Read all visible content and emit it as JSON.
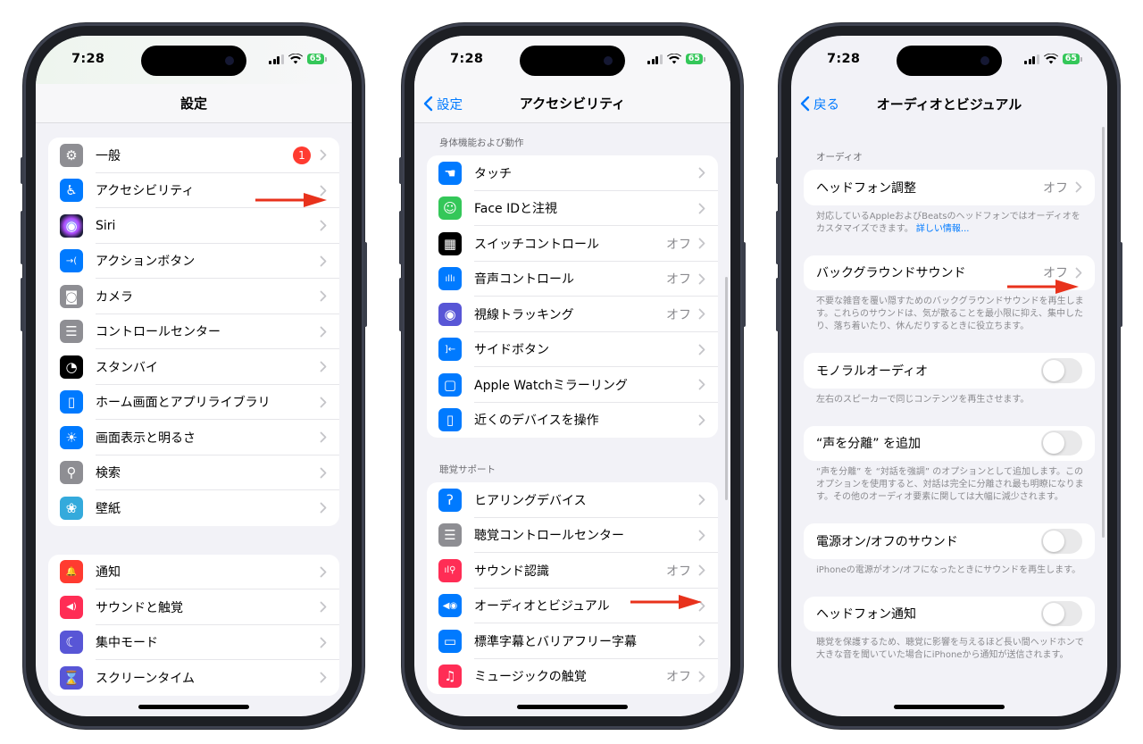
{
  "status_bar": {
    "time": "7:28",
    "battery": "65"
  },
  "phone1": {
    "title": "設定",
    "groups": [
      [
        {
          "label": "一般",
          "icon": "gear-icon",
          "color": "#8e8e93",
          "badge": "1"
        },
        {
          "label": "アクセシビリティ",
          "icon": "accessibility-icon",
          "color": "#007aff",
          "highlighted": true
        },
        {
          "label": "Siri",
          "icon": "siri-icon",
          "color": "#2d2d55"
        },
        {
          "label": "アクションボタン",
          "icon": "action-button-icon",
          "color": "#007aff"
        },
        {
          "label": "カメラ",
          "icon": "camera-icon",
          "color": "#8e8e93"
        },
        {
          "label": "コントロールセンター",
          "icon": "control-center-icon",
          "color": "#8e8e93"
        },
        {
          "label": "スタンバイ",
          "icon": "standby-icon",
          "color": "#000000"
        },
        {
          "label": "ホーム画面とアプリライブラリ",
          "icon": "home-screen-icon",
          "color": "#007aff"
        },
        {
          "label": "画面表示と明るさ",
          "icon": "brightness-icon",
          "color": "#007aff"
        },
        {
          "label": "検索",
          "icon": "search-icon",
          "color": "#8e8e93"
        },
        {
          "label": "壁紙",
          "icon": "wallpaper-icon",
          "color": "#34aadc"
        }
      ],
      [
        {
          "label": "通知",
          "icon": "notification-icon",
          "color": "#ff3b30"
        },
        {
          "label": "サウンドと触覚",
          "icon": "sound-icon",
          "color": "#ff2d55"
        },
        {
          "label": "集中モード",
          "icon": "focus-moon-icon",
          "color": "#5856d6"
        },
        {
          "label": "スクリーンタイム",
          "icon": "hourglass-icon",
          "color": "#5856d6"
        }
      ]
    ]
  },
  "phone2": {
    "back": "設定",
    "title": "アクセシビリティ",
    "sections": [
      {
        "header": "身体機能および動作",
        "items": [
          {
            "label": "タッチ",
            "icon": "touch-hand-icon",
            "color": "#007aff"
          },
          {
            "label": "Face IDと注視",
            "icon": "face-id-icon",
            "color": "#34c759"
          },
          {
            "label": "スイッチコントロール",
            "icon": "switch-control-icon",
            "color": "#000000",
            "value": "オフ"
          },
          {
            "label": "音声コントロール",
            "icon": "voice-control-icon",
            "color": "#007aff",
            "value": "オフ"
          },
          {
            "label": "視線トラッキング",
            "icon": "eye-tracking-icon",
            "color": "#5856d6",
            "value": "オフ"
          },
          {
            "label": "サイドボタン",
            "icon": "side-button-icon",
            "color": "#007aff"
          },
          {
            "label": "Apple Watchミラーリング",
            "icon": "apple-watch-icon",
            "color": "#007aff"
          },
          {
            "label": "近くのデバイスを操作",
            "icon": "nearby-device-icon",
            "color": "#007aff"
          }
        ]
      },
      {
        "header": "聴覚サポート",
        "items": [
          {
            "label": "ヒアリングデバイス",
            "icon": "ear-icon",
            "color": "#007aff"
          },
          {
            "label": "聴覚コントロールセンター",
            "icon": "control-center-icon",
            "color": "#8e8e93"
          },
          {
            "label": "サウンド認識",
            "icon": "sound-recognition-icon",
            "color": "#ff2d55",
            "value": "オフ"
          },
          {
            "label": "オーディオとビジュアル",
            "icon": "audio-visual-icon",
            "color": "#007aff",
            "highlighted": true
          },
          {
            "label": "標準字幕とバリアフリー字幕",
            "icon": "subtitles-icon",
            "color": "#007aff"
          },
          {
            "label": "ミュージックの触覚",
            "icon": "music-haptics-icon",
            "color": "#ff2d55",
            "value": "オフ"
          }
        ]
      }
    ]
  },
  "phone3": {
    "back": "戻る",
    "title": "オーディオとビジュアル",
    "section_header": "オーディオ",
    "items": [
      {
        "label": "ヘッドフォン調整",
        "type": "link",
        "value": "オフ",
        "footer": "対応しているAppleおよびBeatsのヘッドフォンではオーディオをカスタマイズできます。",
        "footer_link": "詳しい情報..."
      },
      {
        "label": "バックグラウンドサウンド",
        "type": "link",
        "value": "オフ",
        "highlighted": true,
        "footer": "不要な雑音を覆い隠すためのバックグラウンドサウンドを再生します。これらのサウンドは、気が散ることを最小限に抑え、集中したり、落ち着いたり、休んだりするときに役立ちます。"
      },
      {
        "label": "モノラルオーディオ",
        "type": "toggle",
        "on": false,
        "footer": "左右のスピーカーで同じコンテンツを再生させます。"
      },
      {
        "label": "“声を分離” を追加",
        "type": "toggle",
        "on": false,
        "footer": "“声を分離” を “対話を強調” のオプションとして追加します。このオプションを使用すると、対話は完全に分離され最も明瞭になります。その他のオーディオ要素に関しては大幅に減少されます。"
      },
      {
        "label": "電源オン/オフのサウンド",
        "type": "toggle",
        "on": false,
        "footer": "iPhoneの電源がオン/オフになったときにサウンドを再生します。"
      },
      {
        "label": "ヘッドフォン通知",
        "type": "toggle",
        "on": false,
        "footer": "聴覚を保護するため、聴覚に影響を与えるほど長い間ヘッドホンで大きな音を聞いていた場合にiPhoneから通知が送信されます。"
      }
    ]
  },
  "colors": {
    "accent": "#007aff",
    "annotation_arrow": "#e8321c",
    "badge": "#ff3b30"
  }
}
